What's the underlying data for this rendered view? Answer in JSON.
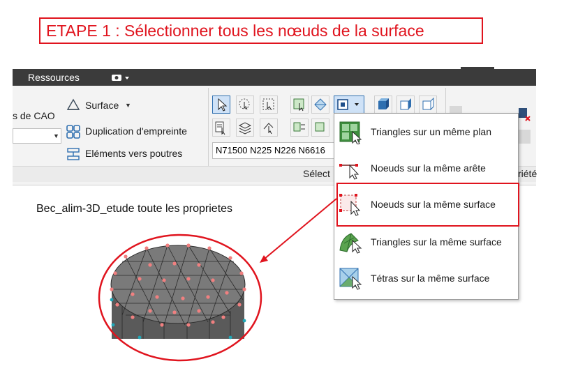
{
  "step_banner": "ETAPE 1 : Sélectionner tous les nœuds de la surface",
  "ribbon": {
    "tab_ressources": "Ressources",
    "groups": {
      "selection_label": "Sélect",
      "proprietes_label": "riété"
    },
    "cad_label": "s de CAO",
    "commands": {
      "surface": "Surface",
      "duplication": "Duplication d'empreinte",
      "elements_poutres": "Eléments vers poutres"
    },
    "node_field_value": "N71500 N225 N226 N6616"
  },
  "dropdown": {
    "items": [
      {
        "label": "Triangles sur un même plan",
        "icon": "triangles-plane-icon"
      },
      {
        "label": "Noeuds sur la même arête",
        "icon": "nodes-edge-icon"
      },
      {
        "label": "Noeuds sur la même surface",
        "icon": "nodes-surface-icon"
      },
      {
        "label": "Triangles sur la même surface",
        "icon": "triangles-surface-icon"
      },
      {
        "label": "Tétras sur la même surface",
        "icon": "tetras-surface-icon"
      }
    ]
  },
  "model": {
    "title": "Bec_alim-3D_etude toute les proprietes"
  },
  "colors": {
    "annotation_red": "#e0141e",
    "ribbon_dark": "#3b3b3b",
    "mesh_face": "#7a7a7a",
    "mesh_node": "#f08080"
  }
}
